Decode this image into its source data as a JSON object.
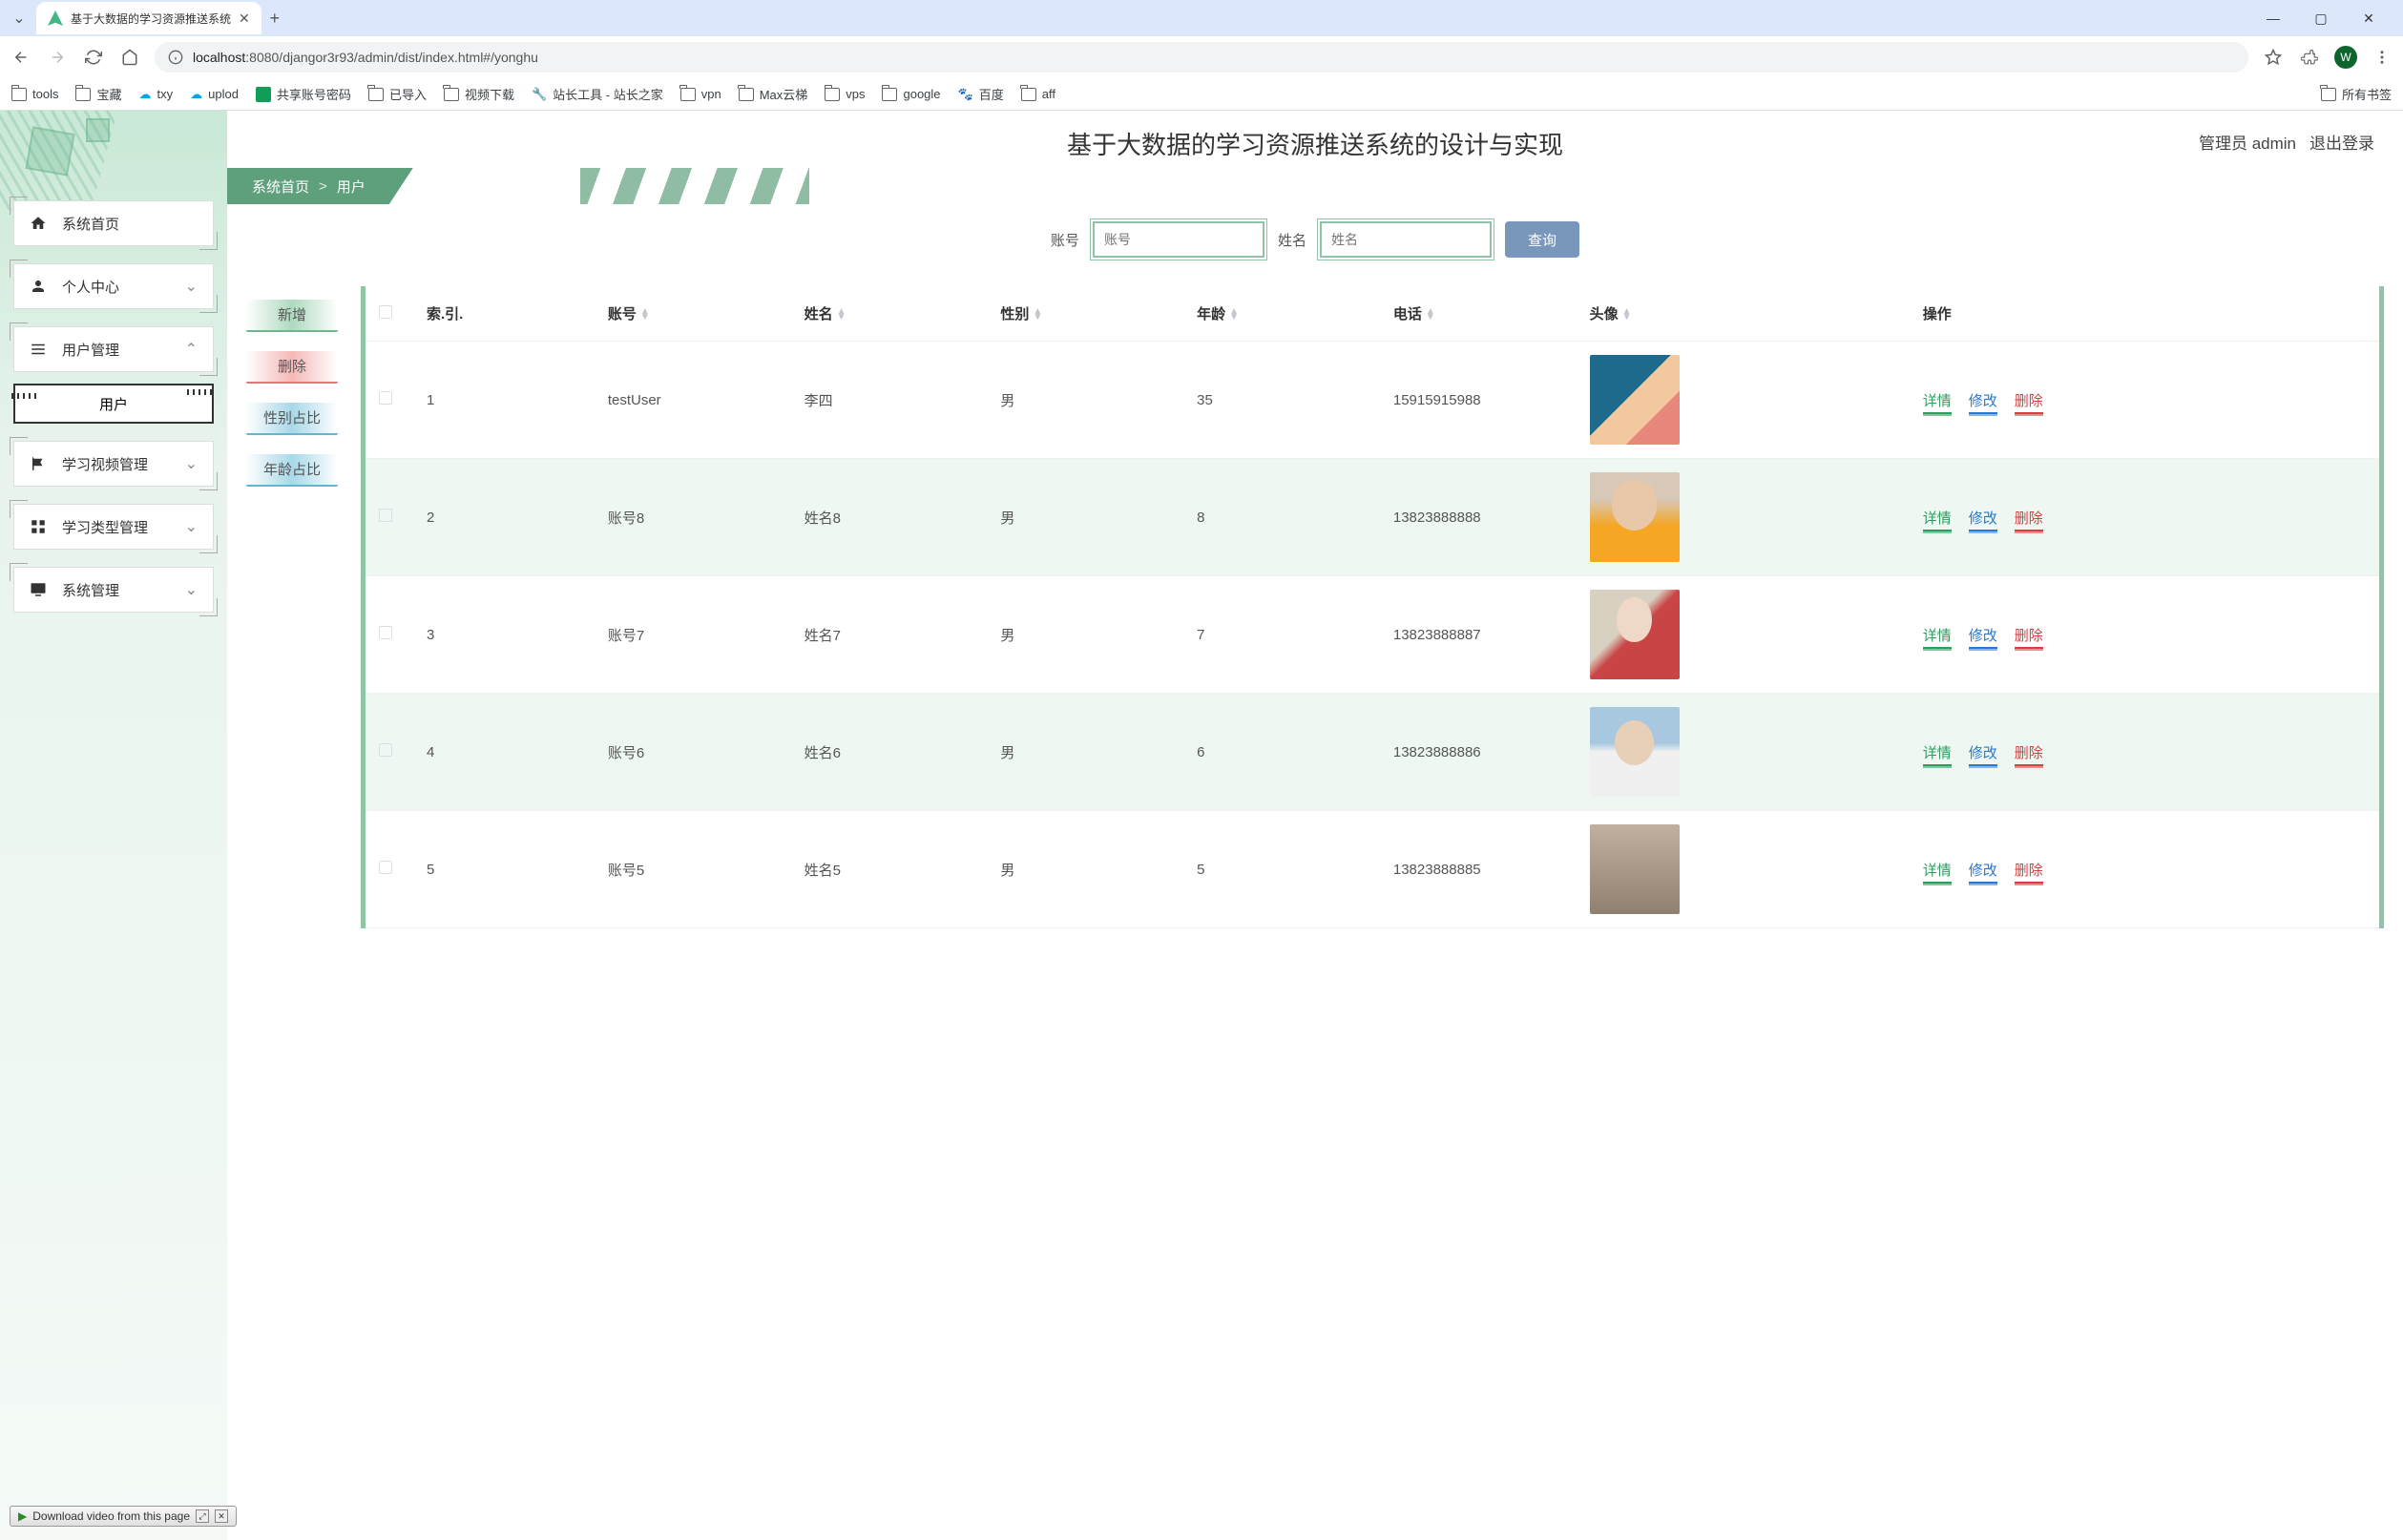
{
  "browser": {
    "tab_title": "基于大数据的学习资源推送系统",
    "url_host": "localhost",
    "url_path": ":8080/djangor3r93/admin/dist/index.html#/yonghu",
    "avatar_letter": "W"
  },
  "bookmarks": {
    "items": [
      "tools",
      "宝藏",
      "txy",
      "uplod",
      "共享账号密码",
      "已导入",
      "视频下载",
      "站长工具 - 站长之家",
      "vpn",
      "Max云梯",
      "vps",
      "google",
      "百度",
      "aff"
    ],
    "all": "所有书签"
  },
  "header": {
    "title": "基于大数据的学习资源推送系统的设计与实现",
    "admin_label": "管理员 admin",
    "logout": "退出登录"
  },
  "breadcrumb": {
    "home": "系统首页",
    "current": "用户"
  },
  "sidebar": {
    "home": "系统首页",
    "personal": "个人中心",
    "user_mgmt": "用户管理",
    "user_sub": "用户",
    "video_mgmt": "学习视频管理",
    "type_mgmt": "学习类型管理",
    "sys_mgmt": "系统管理"
  },
  "search": {
    "account_label": "账号",
    "account_placeholder": "账号",
    "name_label": "姓名",
    "name_placeholder": "姓名",
    "button": "查询"
  },
  "actions": {
    "add": "新增",
    "delete": "删除",
    "gender_ratio": "性别占比",
    "age_ratio": "年龄占比"
  },
  "table": {
    "headers": {
      "index": "索.引.",
      "account": "账号",
      "name": "姓名",
      "gender": "性别",
      "age": "年龄",
      "phone": "电话",
      "avatar": "头像",
      "ops": "操作"
    },
    "op_labels": {
      "detail": "详情",
      "edit": "修改",
      "delete": "删除"
    },
    "rows": [
      {
        "idx": "1",
        "account": "testUser",
        "name": "李四",
        "gender": "男",
        "age": "35",
        "phone": "15915915988",
        "avatar": "av1"
      },
      {
        "idx": "2",
        "account": "账号8",
        "name": "姓名8",
        "gender": "男",
        "age": "8",
        "phone": "13823888888",
        "avatar": "av2"
      },
      {
        "idx": "3",
        "account": "账号7",
        "name": "姓名7",
        "gender": "男",
        "age": "7",
        "phone": "13823888887",
        "avatar": "av3"
      },
      {
        "idx": "4",
        "account": "账号6",
        "name": "姓名6",
        "gender": "男",
        "age": "6",
        "phone": "13823888886",
        "avatar": "av4"
      },
      {
        "idx": "5",
        "account": "账号5",
        "name": "姓名5",
        "gender": "男",
        "age": "5",
        "phone": "13823888885",
        "avatar": "av5"
      }
    ]
  },
  "download_bar": {
    "text": "Download video from this page"
  }
}
